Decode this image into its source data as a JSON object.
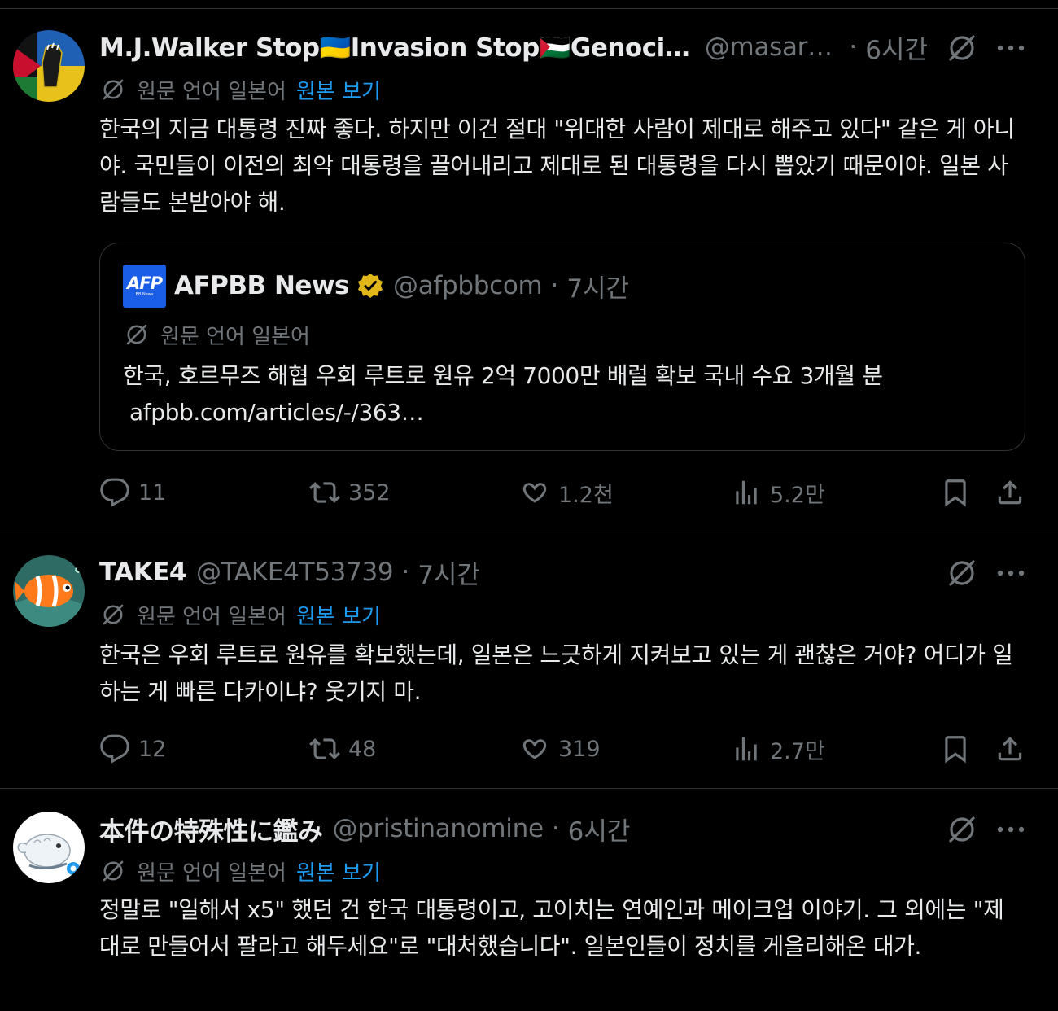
{
  "tweets": [
    {
      "name": "M.J.Walker Stop🇺🇦Invasion Stop🇵🇸Genocide…",
      "handle": "@masara…",
      "dot": "·",
      "time": "6시간",
      "translation_label": "원문 언어 일본어",
      "show_original": "원본 보기",
      "text": "한국의 지금 대통령 진짜 좋다. 하지만 이건 절대 \"위대한 사람이 제대로 해주고 있다\" 같은 게 아니야. 국민들이 이전의 최악 대통령을 끌어내리고 제대로 된 대통령을 다시 뽑았기 때문이야. 일본 사람들도 본받아야 해.",
      "quote": {
        "logo_text": "AFP",
        "logo_subtext": "BB News",
        "name": "AFPBB News",
        "handle": "@afpbbcom",
        "dot": "·",
        "time": "7시간",
        "translation_label": "원문 언어 일본어",
        "text": "한국, 호르무즈 해협 우회 루트로 원유 2억 7000만 배럴 확보  국내 수요 3개월 분",
        "link": "afpbb.com/articles/-/363…"
      },
      "replies": "11",
      "reposts": "352",
      "likes": "1.2천",
      "views": "5.2만"
    },
    {
      "name": "TAKE4",
      "handle": "@TAKE4T53739",
      "dot": "·",
      "time": "7시간",
      "translation_label": "원문 언어 일본어",
      "show_original": "원본 보기",
      "text": "한국은 우회 루트로 원유를 확보했는데, 일본은 느긋하게 지켜보고 있는 게 괜찮은 거야? 어디가 일하는 게 빠른 다카이냐? 웃기지 마.",
      "replies": "12",
      "reposts": "48",
      "likes": "319",
      "views": "2.7만"
    },
    {
      "name": "本件の特殊性に鑑み",
      "handle": "@pristinanomine",
      "dot": "·",
      "time": "6시간",
      "translation_label": "원문 언어 일본어",
      "show_original": "원본 보기",
      "text": "정말로 \"일해서 x5\" 했던 건 한국 대통령이고, 고이치는 연예인과 메이크업 이야기. 그 외에는 \"제대로 만들어서 팔라고 해두세요\"로 \"대처했습니다\". 일본인들이 정치를 게을리해온 대가."
    }
  ],
  "colors": {
    "background": "#000000",
    "text": "#e7e9ea",
    "muted": "#71767b",
    "link": "#1d9bf0",
    "border": "#2f3336",
    "verified_gold": "#e2b719",
    "afp_blue": "#1a5de6"
  },
  "icons": [
    "grok-icon",
    "more-icon",
    "translate-icon",
    "reply-icon",
    "repost-icon",
    "like-icon",
    "views-icon",
    "bookmark-icon",
    "share-icon",
    "verified-badge-icon"
  ]
}
